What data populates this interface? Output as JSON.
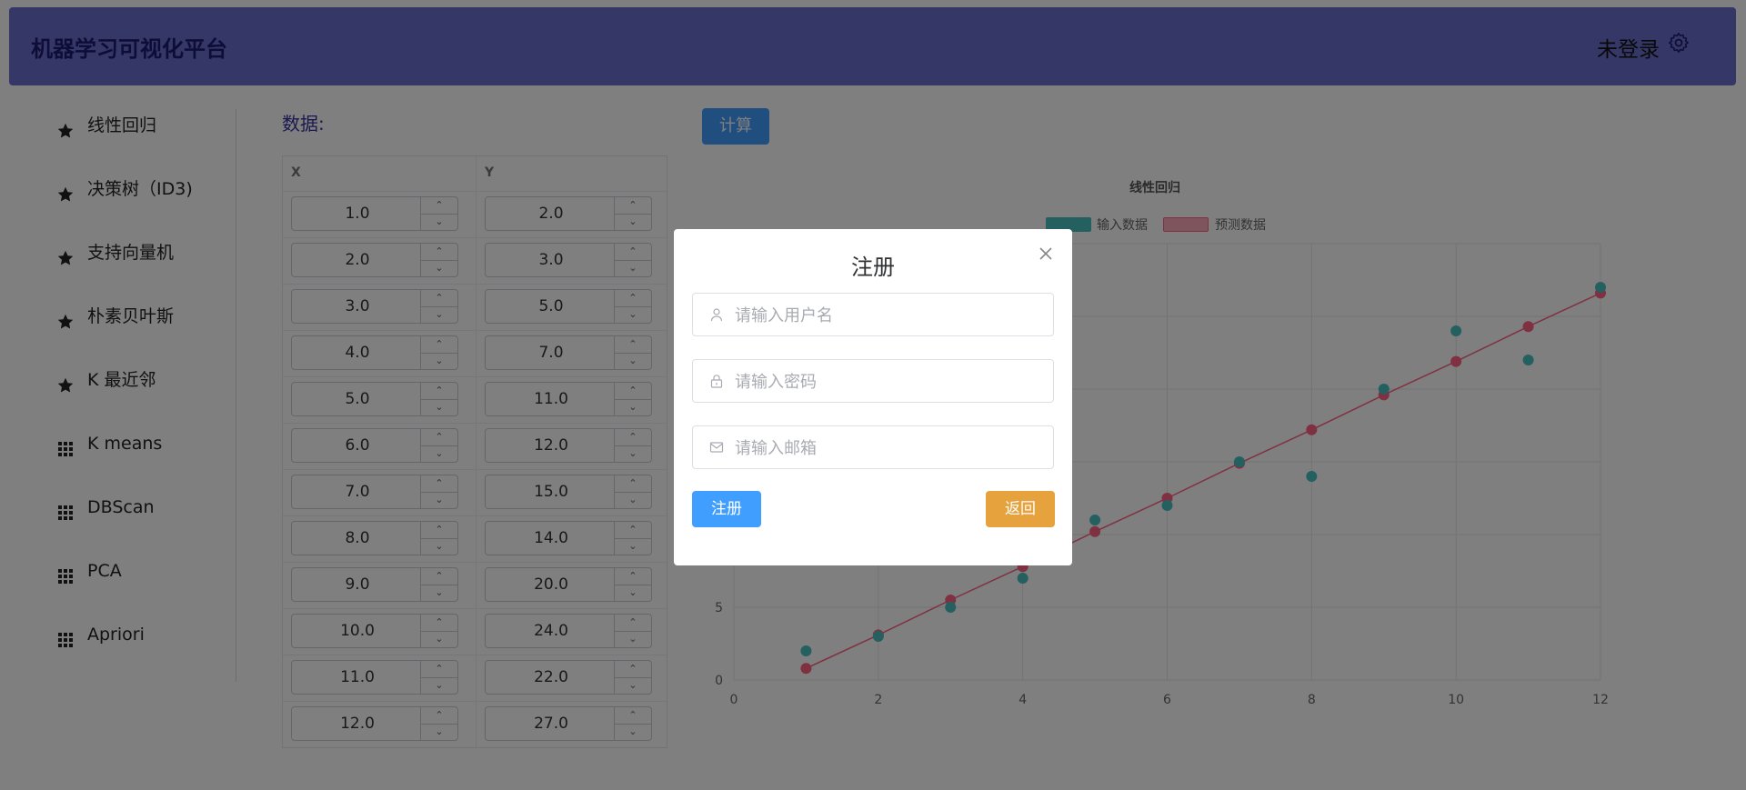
{
  "header": {
    "title": "机器学习可视化平台",
    "login_status": "未登录",
    "settings_icon": "gear-icon"
  },
  "sidebar": {
    "items": [
      {
        "label": "线性回归",
        "icon": "star-icon"
      },
      {
        "label": "决策树（ID3)",
        "icon": "star-icon"
      },
      {
        "label": "支持向量机",
        "icon": "star-icon"
      },
      {
        "label": "朴素贝叶斯",
        "icon": "star-icon"
      },
      {
        "label": "K 最近邻",
        "icon": "star-icon"
      },
      {
        "label": "K means",
        "icon": "grid-icon"
      },
      {
        "label": "DBScan",
        "icon": "grid-icon"
      },
      {
        "label": "PCA",
        "icon": "grid-icon"
      },
      {
        "label": "Apriori",
        "icon": "grid-icon"
      }
    ]
  },
  "data_panel": {
    "label": "数据:",
    "columns": [
      "X",
      "Y"
    ],
    "rows": [
      [
        "1.0",
        "2.0"
      ],
      [
        "2.0",
        "3.0"
      ],
      [
        "3.0",
        "5.0"
      ],
      [
        "4.0",
        "7.0"
      ],
      [
        "5.0",
        "11.0"
      ],
      [
        "6.0",
        "12.0"
      ],
      [
        "7.0",
        "15.0"
      ],
      [
        "8.0",
        "14.0"
      ],
      [
        "9.0",
        "20.0"
      ],
      [
        "10.0",
        "24.0"
      ],
      [
        "11.0",
        "22.0"
      ],
      [
        "12.0",
        "27.0"
      ]
    ]
  },
  "calc_button": "计算",
  "colors": {
    "header_bg": "#6b6fcf",
    "primary": "#409eff",
    "warning": "#e6a23c",
    "input_series": "#4bc0c0",
    "predicted_series": "#ff6384"
  },
  "chart_data": {
    "type": "scatter",
    "title": "线性回归",
    "legend_position": "top",
    "xlim": [
      0,
      12
    ],
    "ylim": [
      0,
      30
    ],
    "x_ticks": [
      "0",
      "2",
      "4",
      "6",
      "8",
      "10",
      "12"
    ],
    "y_ticks": [
      "0",
      "5"
    ],
    "grid": true,
    "series": [
      {
        "name": "输入数据",
        "x": [
          1,
          2,
          3,
          4,
          5,
          6,
          7,
          8,
          9,
          10,
          11,
          12
        ],
        "y": [
          2,
          3,
          5,
          7,
          11,
          12,
          15,
          14,
          20,
          24,
          22,
          27
        ]
      },
      {
        "name": "预测数据",
        "x": [
          1,
          2,
          3,
          4,
          5,
          6,
          7,
          8,
          9,
          10,
          11,
          12
        ],
        "y": [
          0.8,
          3.1,
          5.5,
          7.8,
          10.2,
          12.5,
          14.9,
          17.2,
          19.6,
          21.9,
          24.3,
          26.6
        ]
      }
    ]
  },
  "modal": {
    "title": "注册",
    "username_placeholder": "请输入用户名",
    "password_placeholder": "请输入密码",
    "email_placeholder": "请输入邮箱",
    "register_button": "注册",
    "back_button": "返回"
  }
}
